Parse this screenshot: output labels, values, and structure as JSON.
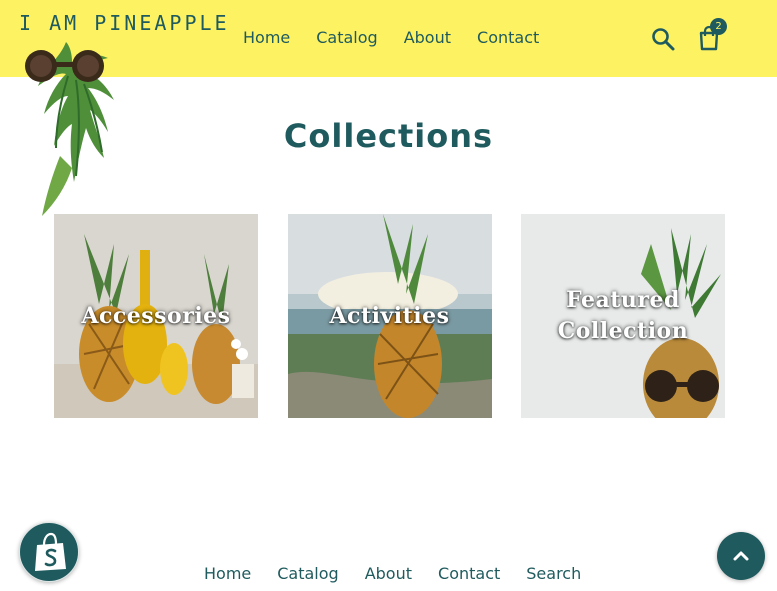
{
  "brand": {
    "name": "I AM PINEAPPLE"
  },
  "nav": {
    "items": [
      {
        "label": "Home"
      },
      {
        "label": "Catalog"
      },
      {
        "label": "About"
      },
      {
        "label": "Contact"
      }
    ]
  },
  "header_icons": {
    "search": "search-icon",
    "cart": "cart-icon",
    "cart_count": "2"
  },
  "page": {
    "title": "Collections"
  },
  "collections": [
    {
      "label": "Accessories"
    },
    {
      "label": "Activities"
    },
    {
      "label": "Featured Collection"
    }
  ],
  "footer": {
    "links": [
      {
        "label": "Home"
      },
      {
        "label": "Catalog"
      },
      {
        "label": "About"
      },
      {
        "label": "Contact"
      },
      {
        "label": "Search"
      }
    ]
  },
  "icons": {
    "shopify": "shopify-bag-icon",
    "back_to_top": "chevron-up-icon"
  },
  "colors": {
    "header_bg": "#fdf262",
    "accent": "#1f5b5e",
    "white": "#ffffff"
  }
}
